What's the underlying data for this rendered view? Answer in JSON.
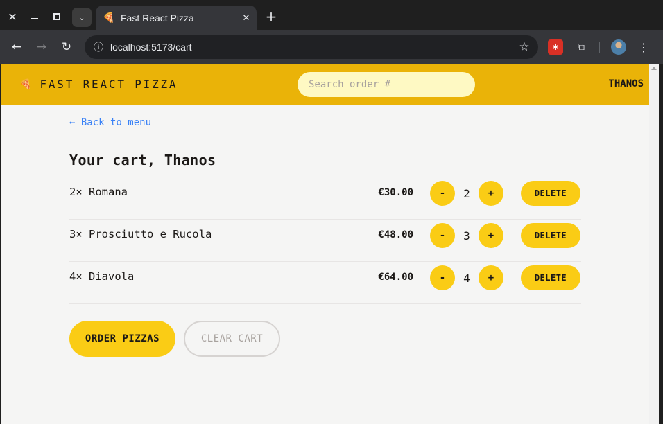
{
  "browser": {
    "tab_title": "Fast React Pizza",
    "tab_favicon": "🍕",
    "url": "localhost:5173/cart",
    "icons": {
      "close_window": "close-icon",
      "minimize": "minimize-icon",
      "maximize": "maximize-icon",
      "tab_search": "chevron-down-icon",
      "back": "arrow-left-icon",
      "forward": "arrow-right-icon",
      "reload": "reload-icon",
      "site_info": "info-icon",
      "bookmark": "star-icon",
      "extension": "puzzle-icon",
      "menu": "more-vertical-icon"
    }
  },
  "header": {
    "logo_icon": "🍕",
    "logo_text": "FAST REACT PIZZA",
    "search_placeholder": "Search order #",
    "username": "THANOS"
  },
  "cart": {
    "back_link": "← Back to menu",
    "title": "Your cart, Thanos",
    "items": [
      {
        "name": "2× Romana",
        "price": "€30.00",
        "quantity": "2",
        "decrease_label": "-",
        "increase_label": "+",
        "delete_label": "DELETE"
      },
      {
        "name": "3× Prosciutto e Rucola",
        "price": "€48.00",
        "quantity": "3",
        "decrease_label": "-",
        "increase_label": "+",
        "delete_label": "DELETE"
      },
      {
        "name": "4× Diavola",
        "price": "€64.00",
        "quantity": "4",
        "decrease_label": "-",
        "increase_label": "+",
        "delete_label": "DELETE"
      }
    ],
    "order_button": "ORDER PIZZAS",
    "clear_button": "CLEAR CART"
  },
  "colors": {
    "header_bg": "#eab308",
    "button_yellow": "#facc15",
    "search_bg": "#fef9c3",
    "page_bg": "#f5f5f4",
    "link_blue": "#3b82f6"
  }
}
